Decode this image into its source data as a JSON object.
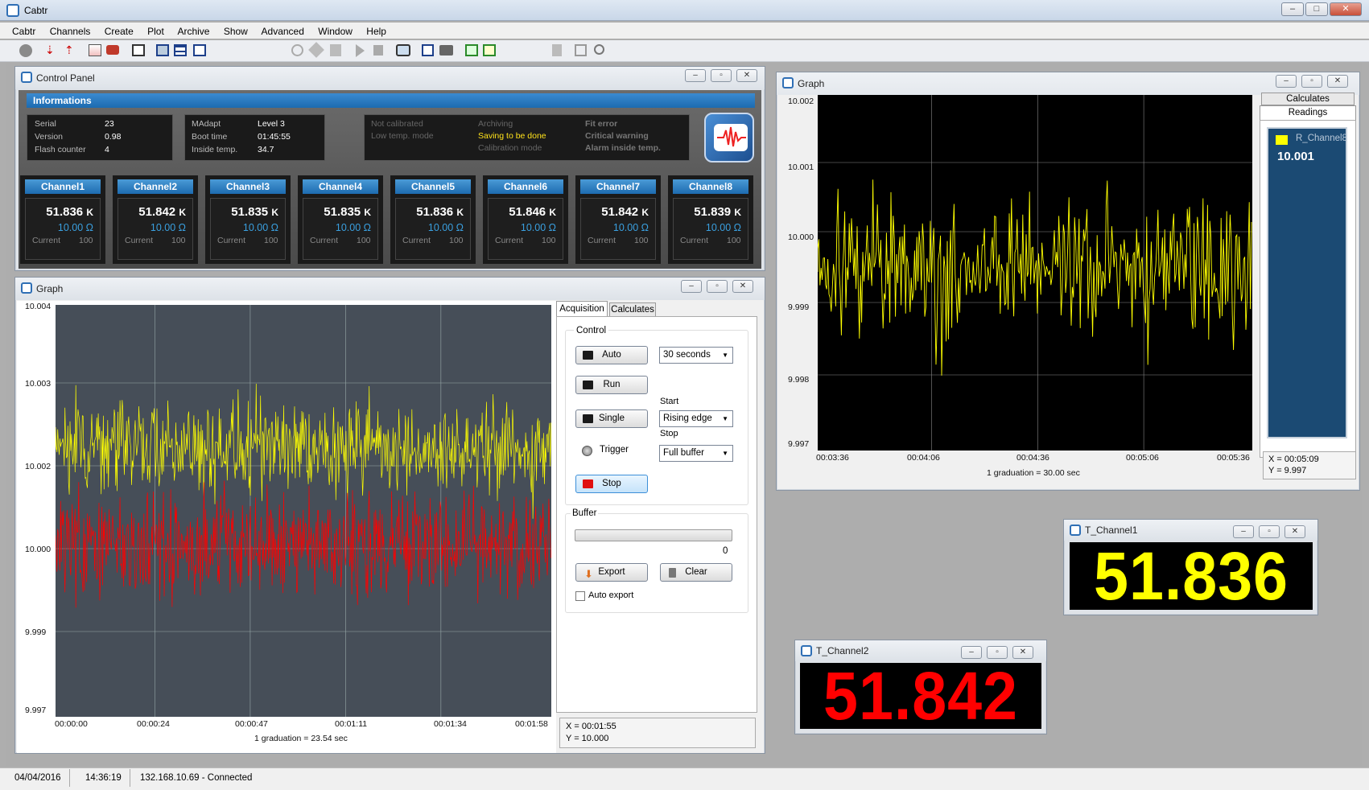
{
  "app": {
    "title": "Cabtr"
  },
  "menu": [
    "Cabtr",
    "Channels",
    "Create",
    "Plot",
    "Archive",
    "Show",
    "Advanced",
    "Window",
    "Help"
  ],
  "control_panel": {
    "title": "Control Panel",
    "info_header": "Informations",
    "box1": {
      "serial_label": "Serial",
      "serial": "23",
      "version_label": "Version",
      "version": "0.98",
      "flash_label": "Flash counter",
      "flash": "4"
    },
    "box2": {
      "madapt_label": "MAdapt",
      "madapt": "Level 3",
      "boot_label": "Boot time",
      "boot": "01:45:55",
      "inside_label": "Inside temp.",
      "inside": "34.7"
    },
    "status": {
      "not_calibrated": "Not calibrated",
      "low_temp": "Low temp. mode",
      "archiving": "Archiving",
      "saving": "Saving to be done",
      "calibration": "Calibration mode",
      "fit_error": "Fit error",
      "critical": "Critical warning",
      "alarm": "Alarm inside temp."
    },
    "channels": [
      {
        "name": "Channel1",
        "value": "51.836",
        "unit": "K",
        "res": "10.00 Ω",
        "cur_label": "Current",
        "cur": "100"
      },
      {
        "name": "Channel2",
        "value": "51.842",
        "unit": "K",
        "res": "10.00 Ω",
        "cur_label": "Current",
        "cur": "100"
      },
      {
        "name": "Channel3",
        "value": "51.835",
        "unit": "K",
        "res": "10.00 Ω",
        "cur_label": "Current",
        "cur": "100"
      },
      {
        "name": "Channel4",
        "value": "51.835",
        "unit": "K",
        "res": "10.00 Ω",
        "cur_label": "Current",
        "cur": "100"
      },
      {
        "name": "Channel5",
        "value": "51.836",
        "unit": "K",
        "res": "10.00 Ω",
        "cur_label": "Current",
        "cur": "100"
      },
      {
        "name": "Channel6",
        "value": "51.846",
        "unit": "K",
        "res": "10.00 Ω",
        "cur_label": "Current",
        "cur": "100"
      },
      {
        "name": "Channel7",
        "value": "51.842",
        "unit": "K",
        "res": "10.00 Ω",
        "cur_label": "Current",
        "cur": "100"
      },
      {
        "name": "Channel8",
        "value": "51.839",
        "unit": "K",
        "res": "10.00 Ω",
        "cur_label": "Current",
        "cur": "100"
      }
    ]
  },
  "graph1": {
    "title": "Graph",
    "yticks": [
      "10.004",
      "10.003",
      "10.002",
      "10.000",
      "9.999",
      "9.997"
    ],
    "xticks": [
      "00:00:00",
      "00:00:24",
      "00:00:47",
      "00:01:11",
      "00:01:34",
      "00:01:58"
    ],
    "graduation": "1 graduation = 23.54 sec",
    "tabs": {
      "acq": "Acquisition",
      "calc": "Calculates"
    },
    "control_label": "Control",
    "auto": "Auto",
    "run": "Run",
    "single": "Single",
    "trigger": "Trigger",
    "stop": "Stop",
    "period": "30 seconds",
    "start_label": "Start",
    "start_value": "Rising edge",
    "stop_label": "Stop",
    "stop_value": "Full buffer",
    "buffer_label": "Buffer",
    "buffer_count": "0",
    "buffer_fill": 0,
    "export": "Export",
    "clear": "Clear",
    "auto_export": "Auto export",
    "cursor_x": "X = 00:01:55",
    "cursor_y": "Y = 10.000"
  },
  "graph2": {
    "title": "Graph",
    "yticks": [
      "10.002",
      "10.001",
      "10.000",
      "9.999",
      "9.998",
      "9.997"
    ],
    "xticks": [
      "00:03:36",
      "00:04:06",
      "00:04:36",
      "00:05:06",
      "00:05:36"
    ],
    "graduation": "1 graduation = 30.00 sec",
    "tabs": {
      "calc": "Calculates",
      "read": "Readings"
    },
    "reading_name": "R_Channel8",
    "reading_value": "10.001",
    "cursor_x": "X = 00:05:09",
    "cursor_y": "Y = 9.997"
  },
  "tch1": {
    "title": "T_Channel1",
    "value": "51.836"
  },
  "tch2": {
    "title": "T_Channel2",
    "value": "51.842"
  },
  "statusbar": {
    "date": "04/04/2016",
    "time": "14:36:19",
    "conn": "132.168.10.69 - Connected"
  },
  "colors": {
    "yellow": "#ffff00",
    "red": "#ff0000",
    "accent": "#1d6bb0"
  }
}
